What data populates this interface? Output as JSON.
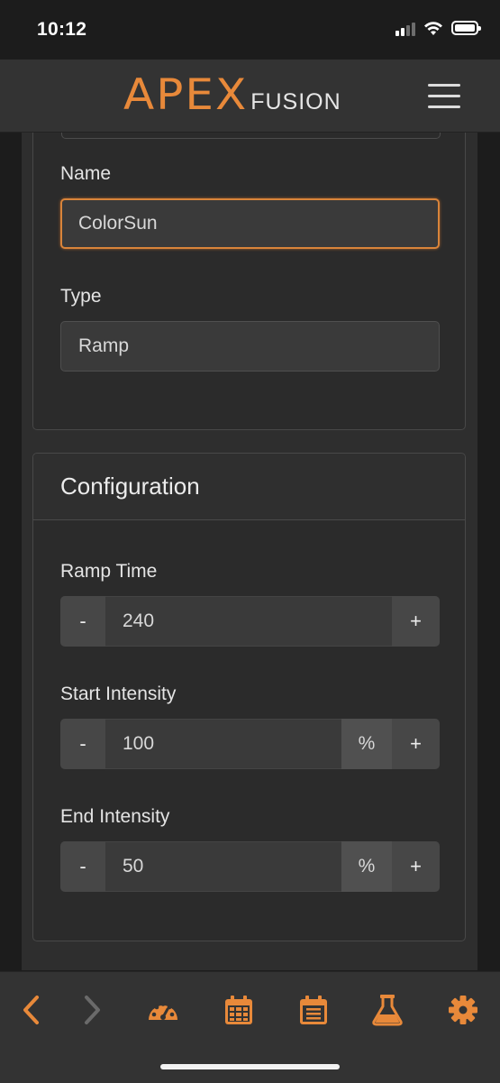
{
  "status_bar": {
    "time": "10:12"
  },
  "header": {
    "logo_main": "APEX",
    "logo_sub": "FUSION"
  },
  "general": {
    "name_label": "Name",
    "name_value": "ColorSun",
    "type_label": "Type",
    "type_value": "Ramp"
  },
  "configuration": {
    "title": "Configuration",
    "ramp_time": {
      "label": "Ramp Time",
      "value": "240",
      "minus": "-",
      "plus": "+"
    },
    "start_intensity": {
      "label": "Start Intensity",
      "value": "100",
      "unit": "%",
      "minus": "-",
      "plus": "+"
    },
    "end_intensity": {
      "label": "End Intensity",
      "value": "50",
      "unit": "%",
      "minus": "-",
      "plus": "+"
    }
  },
  "colors": {
    "accent": "#e8893a",
    "background": "#1c1c1c",
    "panel": "#2b2b2b"
  },
  "bottom_nav": {
    "items": [
      "back-arrow-icon",
      "forward-arrow-icon",
      "dashboard-gauge-icon",
      "calendar-icon",
      "notes-calendar-icon",
      "flask-icon",
      "gear-icon"
    ]
  }
}
